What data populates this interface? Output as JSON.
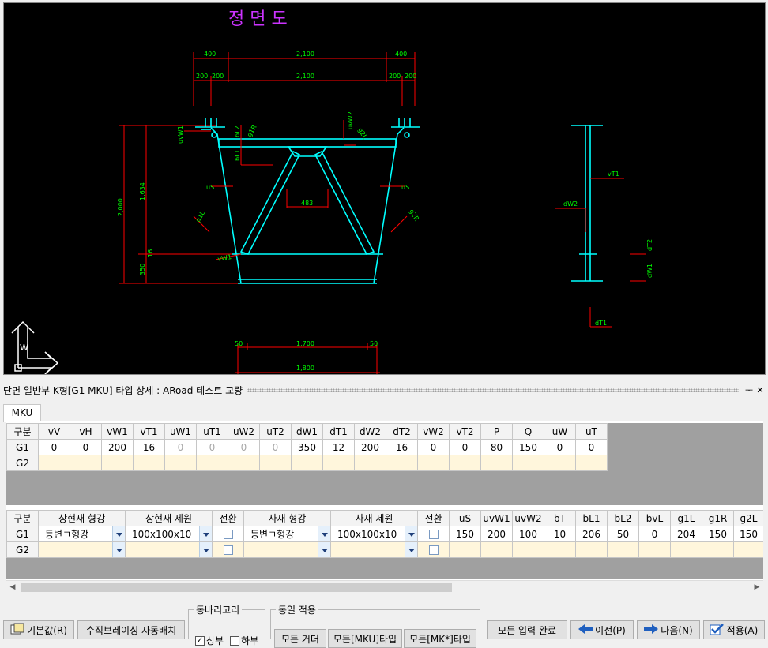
{
  "drawing": {
    "title": "정 면 도",
    "dims_top_row1": [
      "400",
      "2,100",
      "400"
    ],
    "dims_top_row2": [
      "200",
      "200",
      "2,100",
      "200",
      "200"
    ],
    "dim_left_outer": "2,000",
    "dim_left_inner": "1,634",
    "dim_left_bottom": "350",
    "dim_left_small": "16",
    "dims_bottom_row1": [
      "50",
      "1,700",
      "50"
    ],
    "dim_bottom_total": "1,800",
    "dim_brace_gap": "483",
    "labels_front": [
      "uvW1",
      "bL2",
      "bL1",
      "g1R",
      "uvW2",
      "g2L",
      "uS",
      "uS",
      "g1L",
      "g2R",
      "vW1"
    ],
    "labels_side": [
      "vT1",
      "dW2",
      "dT2",
      "dW1",
      "dT1"
    ],
    "axis_label": "W"
  },
  "panel": {
    "title": "단면 일반부 K형[G1 MKU] 타입 상세 : ARoad 테스트 교량",
    "pin_label": "ᅮ",
    "close_label": "✕"
  },
  "tabs": [
    {
      "label": "MKU"
    }
  ],
  "grid1": {
    "headers": [
      "구분",
      "vV",
      "vH",
      "vW1",
      "vT1",
      "uW1",
      "uT1",
      "uW2",
      "uT2",
      "dW1",
      "dT1",
      "dW2",
      "dT2",
      "vW2",
      "vT2",
      "P",
      "Q",
      "uW",
      "uT"
    ],
    "rows": [
      {
        "name": "G1",
        "values": [
          "0",
          "0",
          "200",
          "16",
          "0",
          "0",
          "0",
          "0",
          "350",
          "12",
          "200",
          "16",
          "0",
          "0",
          "80",
          "150",
          "0",
          "0"
        ],
        "disabled": [
          4,
          5,
          6,
          7
        ]
      },
      {
        "name": "G2",
        "values": []
      }
    ]
  },
  "grid2": {
    "headers": [
      "구분",
      "상현재 형강",
      "상현재 제원",
      "전환",
      "사재 형강",
      "사재 제원",
      "전환",
      "uS",
      "uvW1",
      "uvW2",
      "bT",
      "bL1",
      "bL2",
      "bvL",
      "g1L",
      "g1R",
      "g2L"
    ],
    "rows": [
      {
        "name": "G1",
        "upper_shape": "등변ㄱ형강",
        "upper_spec": "100x100x10",
        "diag_shape": "등변ㄱ형강",
        "diag_spec": "100x100x10",
        "values": [
          "150",
          "200",
          "100",
          "10",
          "206",
          "50",
          "0",
          "204",
          "150",
          "150"
        ]
      },
      {
        "name": "G2"
      }
    ]
  },
  "buttons": {
    "default": "기본값(R)",
    "auto_brace": "수직브레이싱 자동배치",
    "all_done": "모든 입력 완료",
    "prev": "이전(P)",
    "next": "다음(N)",
    "apply": "적용(A)"
  },
  "group_bari": {
    "legend": "동바리고리",
    "upper": "상부",
    "lower": "하부",
    "upper_checked": true,
    "lower_checked": false
  },
  "group_same": {
    "legend": "동일 적용",
    "all_girder": "모든 거더",
    "all_mku": "모든[MKU]타입",
    "all_mk": "모든[MK*]타입"
  },
  "colors": {
    "cad_bg": "#000000",
    "cyan": "#00ffff",
    "red": "#ff0000",
    "green": "#00ff00",
    "magenta": "#cc33ff",
    "white": "#ffffff"
  }
}
